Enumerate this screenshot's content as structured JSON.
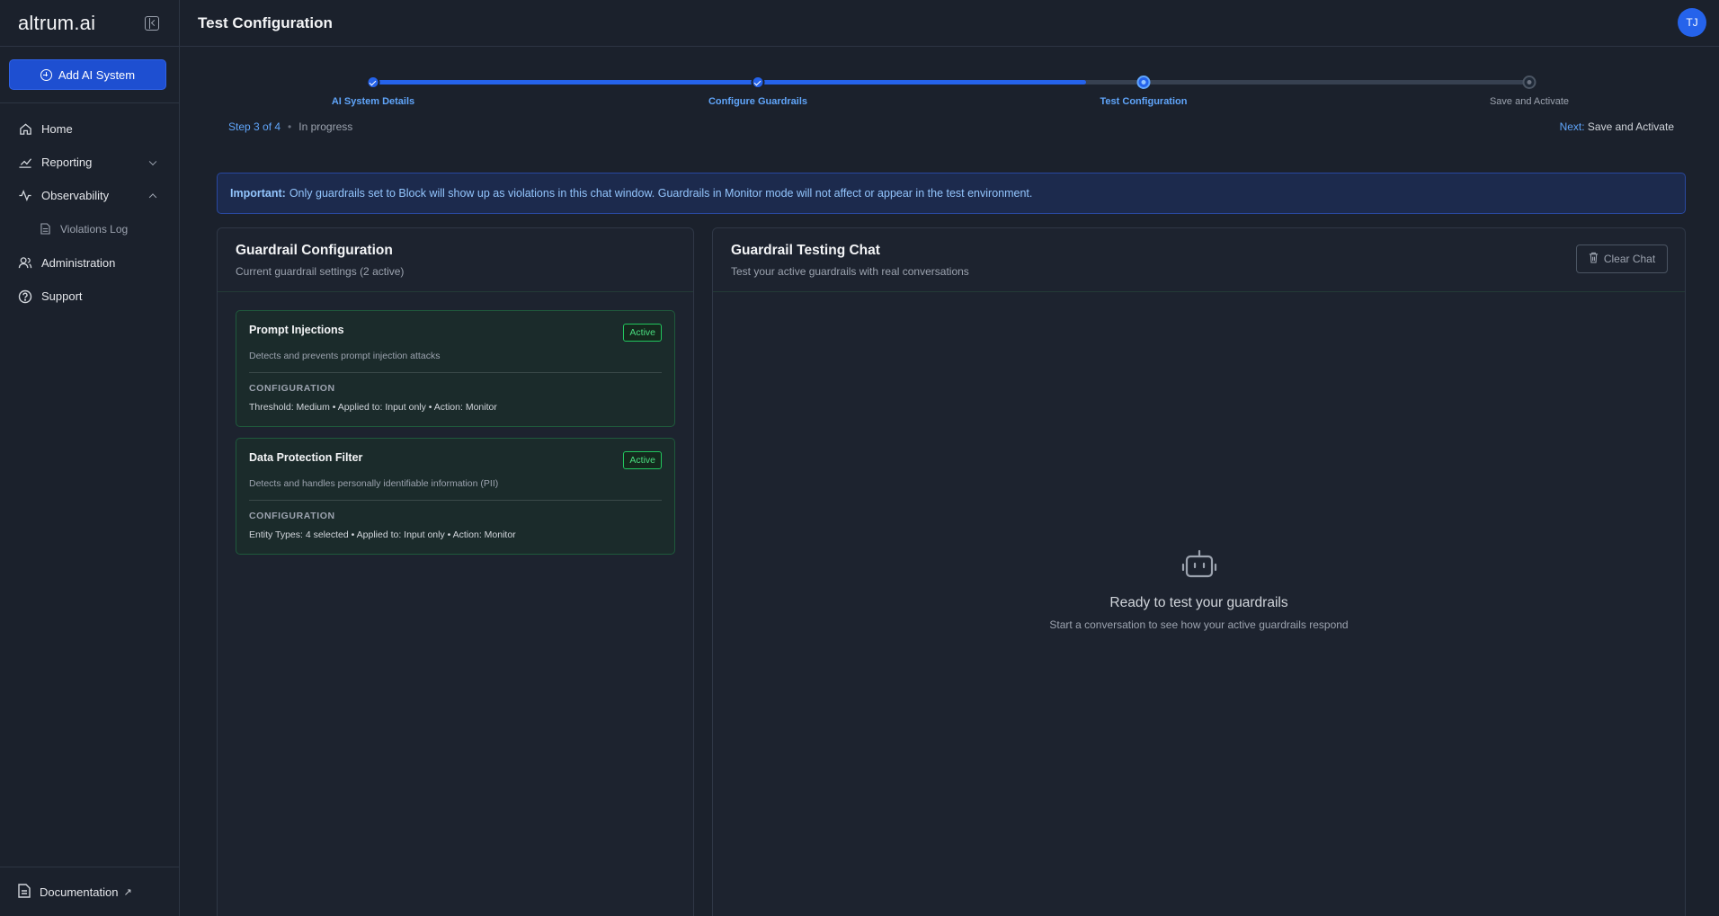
{
  "brand": {
    "logo": "altrum.ai"
  },
  "sidebar": {
    "add_button": "Add AI System",
    "items": [
      {
        "label": "Home",
        "icon": "home-icon"
      },
      {
        "label": "Reporting",
        "icon": "chart-icon"
      },
      {
        "label": "Observability",
        "icon": "activity-icon"
      },
      {
        "label": "Violations Log",
        "icon": "file-icon"
      },
      {
        "label": "Administration",
        "icon": "users-icon"
      },
      {
        "label": "Support",
        "icon": "help-circle-icon"
      }
    ],
    "footer": {
      "label": "Documentation",
      "arrow": "↗"
    }
  },
  "header": {
    "title": "Test Configuration",
    "avatar": "TJ"
  },
  "stepper": {
    "progress": 0.617,
    "steps": [
      {
        "label": "AI System Details",
        "state": "done"
      },
      {
        "label": "Configure Guardrails",
        "state": "done"
      },
      {
        "label": "Test Configuration",
        "state": "current"
      },
      {
        "label": "Save and Activate",
        "state": "pending"
      }
    ],
    "step_count": "Step 3 of 4",
    "separator": "•",
    "status": "In progress",
    "next_label": "Next:",
    "next_value": "Save and Activate"
  },
  "notice": {
    "strong": "Important:",
    "text": "Only guardrails set to Block will show up as violations in this chat window. Guardrails in Monitor mode will not affect or appear in the test environment."
  },
  "config_panel": {
    "title": "Guardrail Configuration",
    "subtitle": "Current guardrail settings (2 active)",
    "cards": [
      {
        "name": "Prompt Injections",
        "badge": "Active",
        "description": "Detects and prevents prompt injection attacks",
        "config_label": "CONFIGURATION",
        "config_value": "Threshold: Medium • Applied to: Input only • Action: Monitor"
      },
      {
        "name": "Data Protection Filter",
        "badge": "Active",
        "description": "Detects and handles personally identifiable information (PII)",
        "config_label": "CONFIGURATION",
        "config_value": "Entity Types: 4 selected • Applied to: Input only • Action: Monitor"
      }
    ]
  },
  "chat_panel": {
    "title": "Guardrail Testing Chat",
    "subtitle": "Test your active guardrails with real conversations",
    "clear_button": "Clear Chat",
    "empty_title": "Ready to test your guardrails",
    "empty_subtitle": "Start a conversation to see how your active guardrails respond"
  },
  "colors": {
    "accent": "#2563eb",
    "active_green": "#4ade80",
    "notice_blue": "#93c5fd",
    "background": "#1b212c"
  }
}
